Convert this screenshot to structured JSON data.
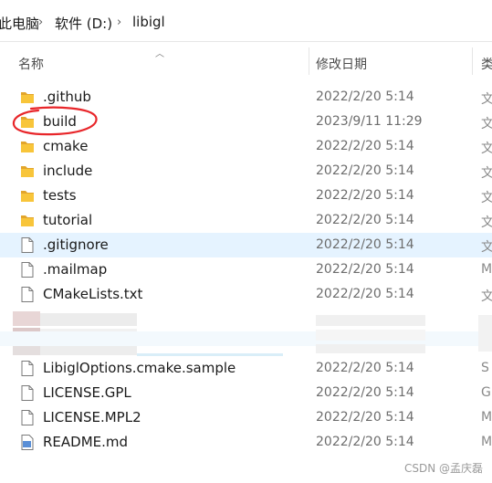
{
  "breadcrumb": {
    "items": [
      "此电脑",
      "软件 (D:)",
      "libigl"
    ],
    "separator": "›"
  },
  "columns": {
    "name": "名称",
    "modified": "修改日期"
  },
  "files": [
    {
      "name": ".github",
      "date": "2022/2/20 5:14",
      "type": "folder",
      "extra": "文"
    },
    {
      "name": "build",
      "date": "2023/9/11 11:29",
      "type": "folder",
      "extra": "文"
    },
    {
      "name": "cmake",
      "date": "2022/2/20 5:14",
      "type": "folder",
      "extra": "文"
    },
    {
      "name": "include",
      "date": "2022/2/20 5:14",
      "type": "folder",
      "extra": "文"
    },
    {
      "name": "tests",
      "date": "2022/2/20 5:14",
      "type": "folder",
      "extra": "文"
    },
    {
      "name": "tutorial",
      "date": "2022/2/20 5:14",
      "type": "folder",
      "extra": "文"
    },
    {
      "name": ".gitignore",
      "date": "2022/2/20 5:14",
      "type": "file",
      "extra": "文"
    },
    {
      "name": ".mailmap",
      "date": "2022/2/20 5:14",
      "type": "file",
      "extra": "M"
    },
    {
      "name": "CMakeLists.txt",
      "date": "2022/2/20 5:14",
      "type": "file",
      "extra": "文"
    },
    {
      "name": "LibiglOptions.cmake.sample",
      "date": "2022/2/20 5:14",
      "type": "file",
      "extra": "S"
    },
    {
      "name": "LICENSE.GPL",
      "date": "2022/2/20 5:14",
      "type": "file",
      "extra": "G"
    },
    {
      "name": "LICENSE.MPL2",
      "date": "2022/2/20 5:14",
      "type": "file",
      "extra": "M"
    },
    {
      "name": "README.md",
      "date": "2022/2/20 5:14",
      "type": "md",
      "extra": "M"
    }
  ],
  "selected_file": ".gitignore",
  "annotated_file": "build",
  "watermark": "CSDN @孟庆磊",
  "colors": {
    "folder": "#f8c53a",
    "folder_dark": "#e2a52b",
    "selected_row": "#e5f3ff",
    "annotation": "#e8262a"
  }
}
